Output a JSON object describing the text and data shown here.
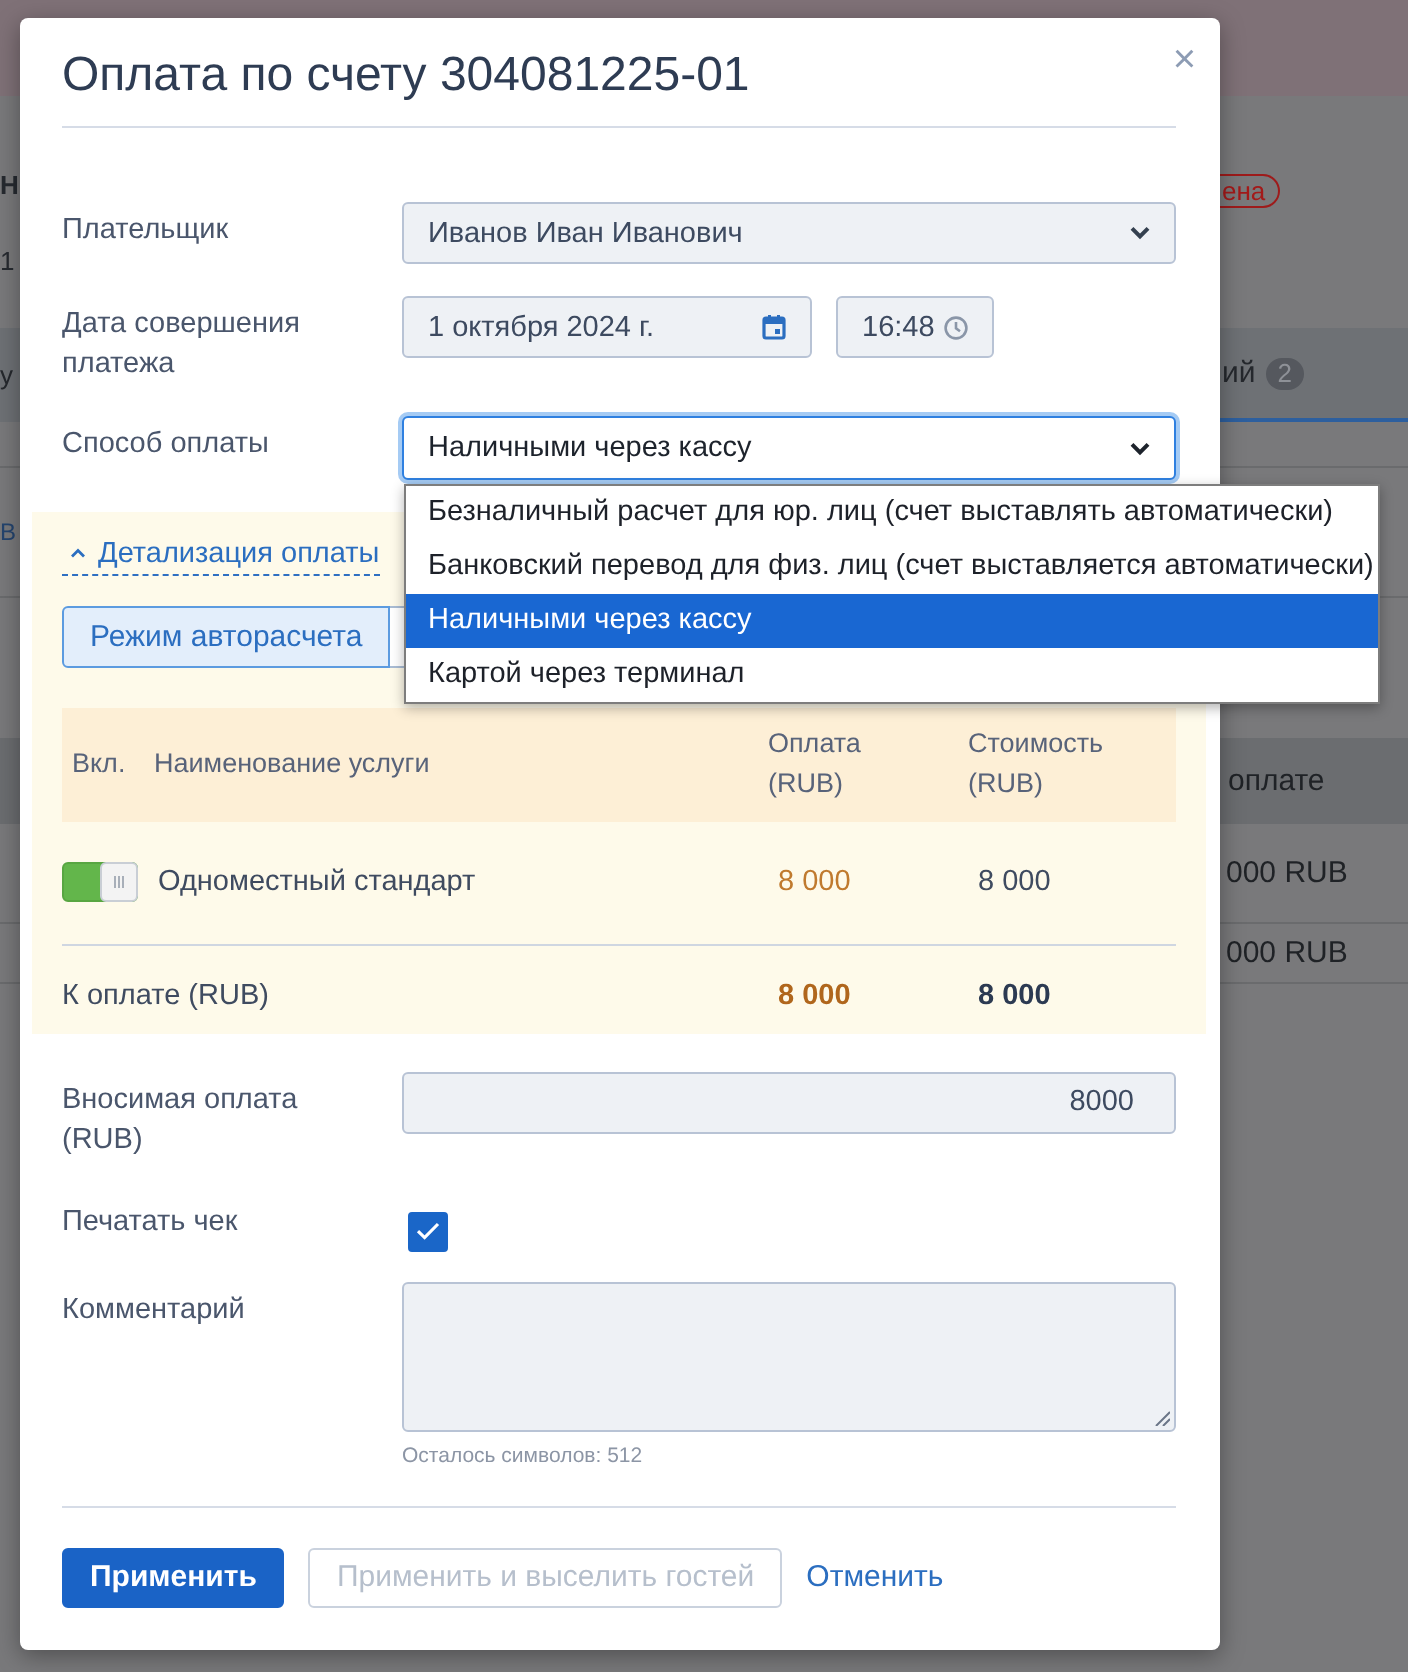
{
  "background_page": {
    "heading_fragment": "Н",
    "subheading_fragment": "1",
    "status_badge": "ена",
    "left_tab_fragment": "у",
    "right_tab": {
      "label": "ий",
      "count": "2",
      "selected": true
    },
    "button_fragment": "В",
    "table_header_fragment": "оплате",
    "table_cells": [
      "000 RUB",
      "000 RUB"
    ]
  },
  "dialog": {
    "title": "Оплата по счету 304081225-01",
    "close": "×",
    "payer": {
      "label": "Плательщик",
      "value": "Иванов Иван Иванович"
    },
    "payment_date": {
      "label": "Дата совершения платежа",
      "date": "1 октября 2024 г.",
      "time": "16:48"
    },
    "payment_method": {
      "label": "Способ оплаты",
      "value": "Наличными через кассу",
      "expanded": true,
      "options": [
        {
          "label": "Безналичный расчет для юр. лиц (счет выставлять автоматически)",
          "selected": false
        },
        {
          "label": "Банковский перевод для физ. лиц (счет выставляется автоматически)",
          "selected": false
        },
        {
          "label": "Наличными через кассу",
          "selected": true
        },
        {
          "label": "Картой через терминал",
          "selected": false
        }
      ]
    },
    "details": {
      "toggle": "Детализация оплаты",
      "expanded": true,
      "modes": [
        {
          "label": "Режим авторасчета",
          "selected": true
        },
        {
          "selected": false
        }
      ],
      "table": {
        "columns": [
          "Вкл.",
          "Наименование услуги",
          "Оплата (RUB)",
          "Стоимость (RUB)"
        ],
        "rows": [
          {
            "enabled": true,
            "service": "Одноместный стандарт",
            "payment": "8 000",
            "cost": "8 000"
          }
        ],
        "total": {
          "label": "К оплате (RUB)",
          "payment": "8 000",
          "cost": "8 000"
        }
      }
    },
    "amount": {
      "label": "Вносимая оплата (RUB)",
      "value": "8000"
    },
    "print_receipt": {
      "label": "Печатать чек",
      "checked": true
    },
    "comment": {
      "label": "Комментарий",
      "remaining": "Осталось символов: 512"
    },
    "buttons": [
      {
        "label": "Применить",
        "kind": "primary",
        "disabled": false
      },
      {
        "label": "Применить и выселить гостей",
        "kind": "secondary",
        "disabled": true
      },
      {
        "label": "Отменить",
        "kind": "link",
        "disabled": false
      }
    ]
  }
}
